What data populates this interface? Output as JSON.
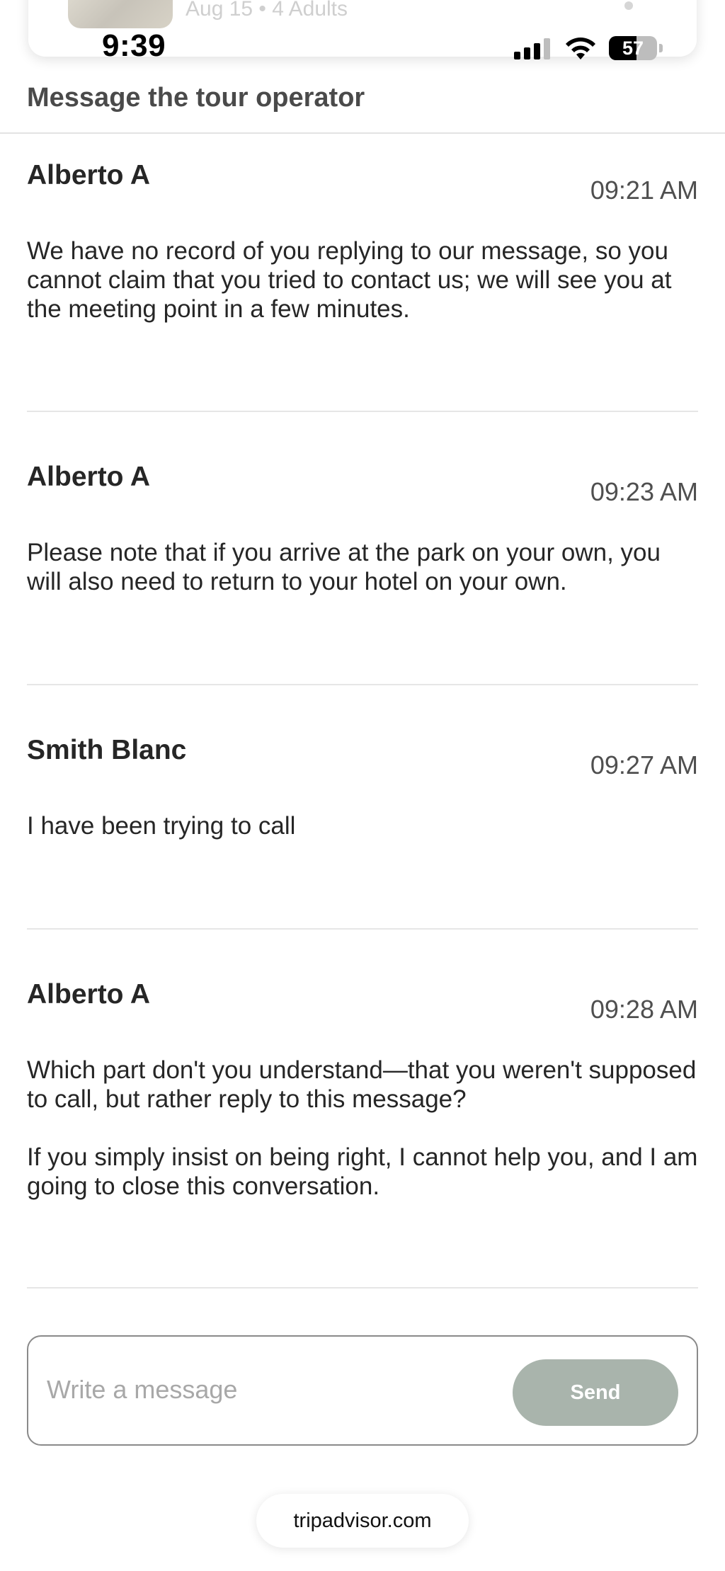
{
  "booking": {
    "meta": "Aug 15 • 4 Adults"
  },
  "status_bar": {
    "time": "9:39",
    "battery": "57",
    "battery_level": 0.57
  },
  "header": {
    "title": "Message the tour operator"
  },
  "messages": [
    {
      "sender": "Alberto A",
      "time": "09:21 AM",
      "body": "We have no record of you replying to our message, so you cannot claim that you tried to contact us; we will see you at the meeting point in a few minutes."
    },
    {
      "sender": "Alberto A",
      "time": "09:23 AM",
      "body": "Please note that if you arrive at the park on your own, you will also need to return to your hotel on your own."
    },
    {
      "sender": "Smith Blanc",
      "time": "09:27 AM",
      "body": "I have been trying to call"
    },
    {
      "sender": "Alberto A",
      "time": "09:28 AM",
      "body": "Which part don't you understand—that you weren't supposed to call, but rather reply to this message?\n\nIf you simply insist on being right, I cannot help you, and I am going to close this conversation."
    }
  ],
  "composer": {
    "placeholder": "Write a message",
    "value": "",
    "send_label": "Send"
  },
  "browser": {
    "url": "tripadvisor.com"
  },
  "colors": {
    "send_button": "#a9b4ac",
    "divider": "#e6e6e6",
    "text": "#262626"
  }
}
